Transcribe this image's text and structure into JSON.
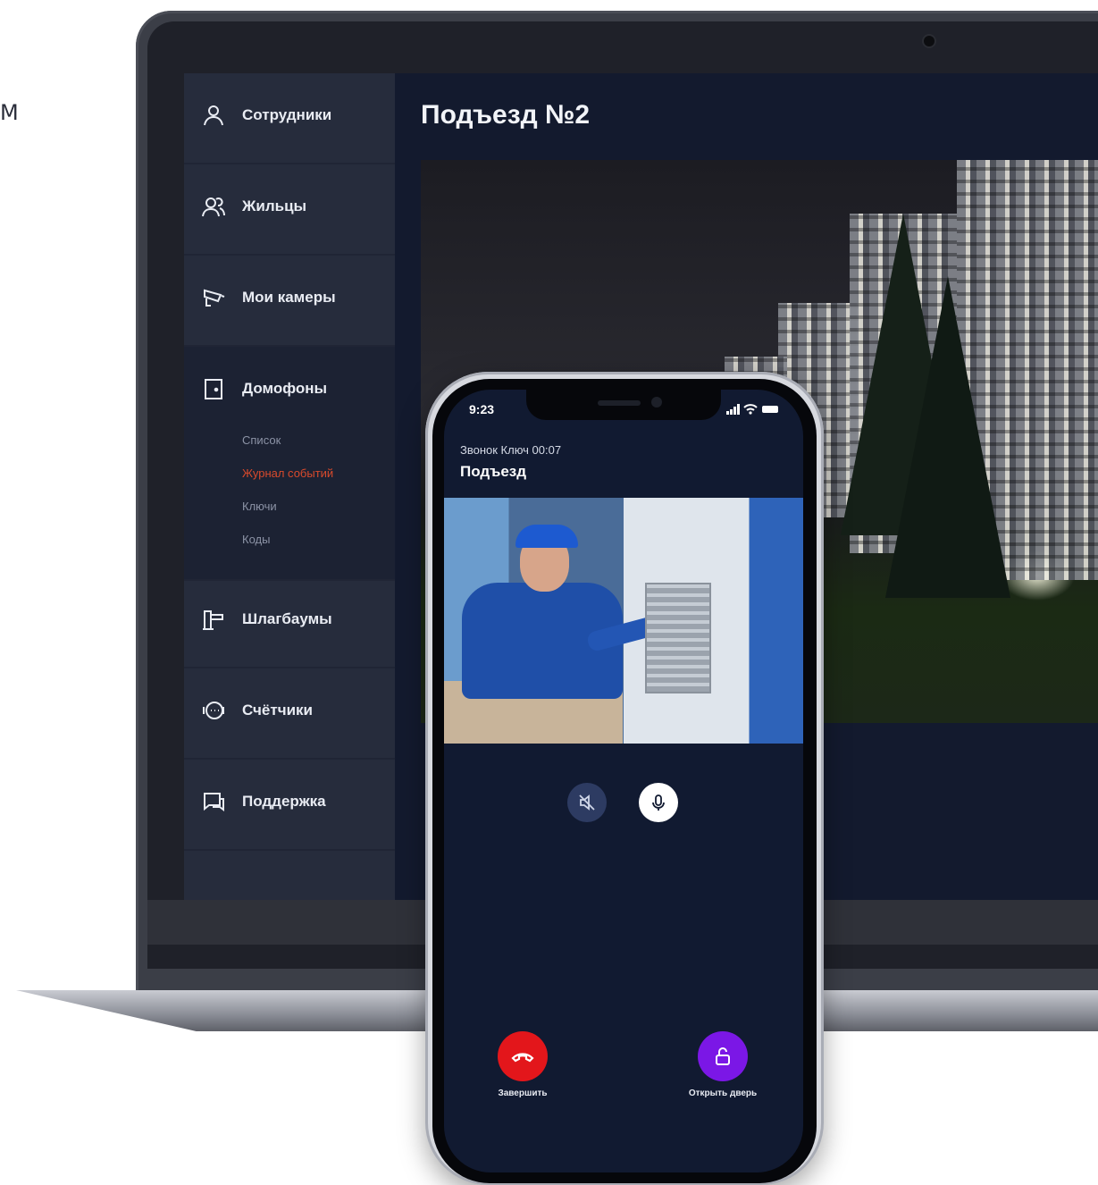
{
  "edge_text": "М",
  "laptop": {
    "title": "Подъезд №2",
    "sidebar": {
      "items": [
        {
          "label": "Сотрудники",
          "icon": "person-icon"
        },
        {
          "label": "Жильцы",
          "icon": "people-icon"
        },
        {
          "label": "Мои камеры",
          "icon": "cctv-camera-icon"
        },
        {
          "label": "Домофоны",
          "icon": "door-icon"
        },
        {
          "label": "Шлагбаумы",
          "icon": "barrier-icon"
        },
        {
          "label": "Счётчики",
          "icon": "meter-icon"
        },
        {
          "label": "Поддержка",
          "icon": "chat-icon"
        }
      ],
      "intercom_sub": [
        {
          "label": "Список",
          "active": false
        },
        {
          "label": "Журнал событий",
          "active": true
        },
        {
          "label": "Ключи",
          "active": false
        },
        {
          "label": "Коды",
          "active": false
        }
      ]
    }
  },
  "phone": {
    "time": "9:23",
    "call_subtitle": "Звонок Ключ 00:07",
    "call_title": "Подъезд",
    "controls": {
      "mute_icon": "speaker-muted-icon",
      "mic_icon": "microphone-icon"
    },
    "end_label": "Завершить",
    "open_label": "Открыть дверь",
    "colors": {
      "end": "#e3161b",
      "open": "#7b17e6",
      "accent": "#d84a2c"
    }
  }
}
